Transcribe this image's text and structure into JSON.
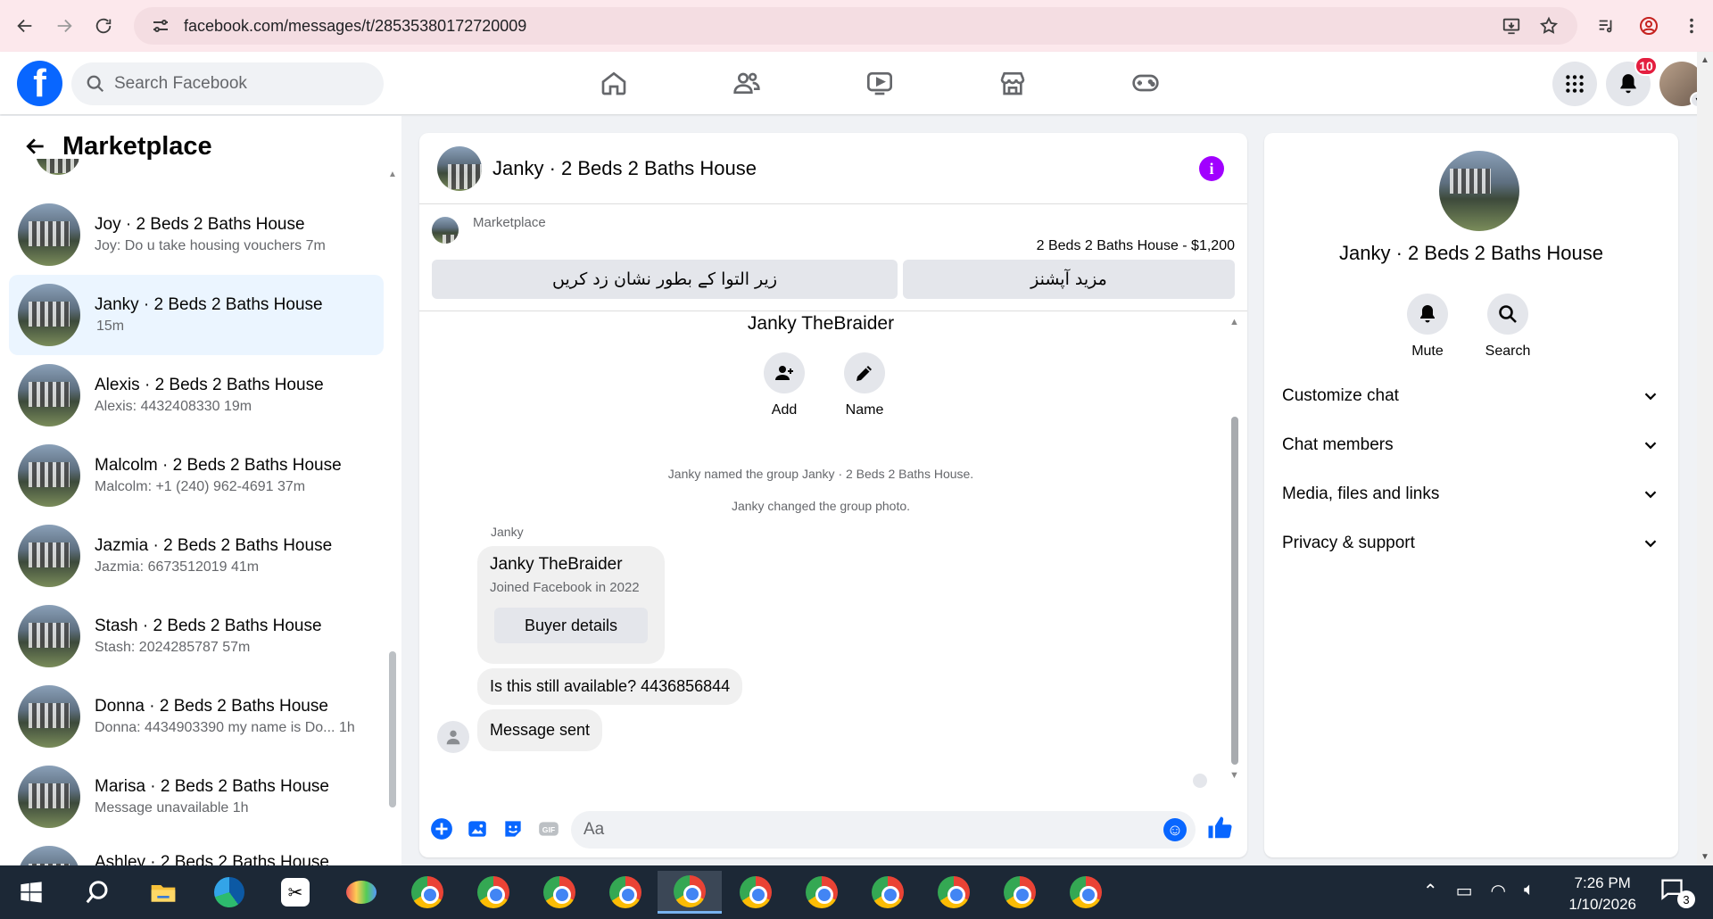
{
  "browser": {
    "url": "facebook.com/messages/t/28535380172720009"
  },
  "facebook": {
    "logo": "f",
    "search_placeholder": "Search Facebook",
    "nav_icons": [
      "home-icon",
      "friends-icon",
      "video-icon",
      "marketplace-icon",
      "gaming-icon"
    ],
    "notification_count": "10"
  },
  "sidebar": {
    "title": "Marketplace",
    "conversations": [
      {
        "title": "Joy · 2 Beds 2 Baths House",
        "subtitle": "Joy: Do u take housing vouchers 7m"
      },
      {
        "title": "Janky · 2 Beds 2 Baths House",
        "subtitle": "15m"
      },
      {
        "title": "Alexis · 2 Beds 2 Baths House",
        "subtitle": "Alexis: 4432408330 19m"
      },
      {
        "title": "Malcolm · 2 Beds 2 Baths House",
        "subtitle": "Malcolm: +1 (240) 962-4691 37m"
      },
      {
        "title": "Jazmia · 2 Beds 2 Baths House",
        "subtitle": "Jazmia: 6673512019 41m"
      },
      {
        "title": "Stash · 2 Beds 2 Baths House",
        "subtitle": "Stash: 2024285787 57m"
      },
      {
        "title": "Donna · 2 Beds 2 Baths House",
        "subtitle": "Donna: 4434903390 my name is Do... 1h"
      },
      {
        "title": "Marisa · 2 Beds 2 Baths House",
        "subtitle": "Message unavailable 1h"
      },
      {
        "title": "Ashley · 2 Beds 2 Baths House",
        "subtitle": ""
      }
    ]
  },
  "chat": {
    "title": "Janky · 2 Beds 2 Baths House",
    "marketplace_label": "Marketplace",
    "listing": "2 Beds 2 Baths House - $1,200",
    "btn_mark_pending": "زیر التوا کے بطور نشان زد کریں",
    "btn_more_options": "مزید آپشنز",
    "group_name": "Janky TheBraider",
    "action_add": "Add",
    "action_name": "Name",
    "sys_1": "Janky named the group Janky · 2 Beds 2 Baths House.",
    "sys_2": "Janky changed the group photo.",
    "sender": "Janky",
    "card_name": "Janky TheBraider",
    "card_joined": "Joined Facebook in 2022",
    "card_button": "Buyer details",
    "msg_question": "Is this still available? 4436856844",
    "msg_sent": "Message sent",
    "composer_placeholder": "Aa"
  },
  "info": {
    "name": "Janky · 2 Beds 2 Baths House",
    "mute": "Mute",
    "search": "Search",
    "sections": [
      "Customize chat",
      "Chat members",
      "Media, files and links",
      "Privacy & support"
    ]
  },
  "taskbar": {
    "time": "7:26 PM",
    "date": "1/10/2026",
    "notifications": "3"
  },
  "colors": {
    "accent": "#0866ff",
    "active_row": "#ebf5ff",
    "info_icon": "#a100ff",
    "badge": "#e41e3f"
  }
}
